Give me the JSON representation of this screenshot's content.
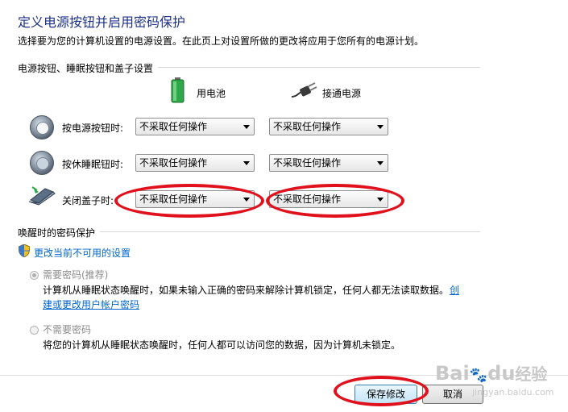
{
  "header": {
    "title": "定义电源按钮并启用密码保护",
    "description": "选择要为您的计算机设置的电源设置。在此页上对设置所做的更改将应用于您所有的电源计划。"
  },
  "power_section": {
    "label": "电源按钮、睡眠按钮和盖子设置",
    "columns": {
      "battery": "用电池",
      "plugged_in": "接通电源"
    },
    "rows": [
      {
        "label": "按电源按钮时:",
        "battery": "不采取任何操作",
        "plugged_in": "不采取任何操作"
      },
      {
        "label": "按休睡眠钮时:",
        "battery": "不采取任何操作",
        "plugged_in": "不采取任何操作"
      },
      {
        "label": "关闭盖子时:",
        "battery": "不采取任何操作",
        "plugged_in": "不采取任何操作"
      }
    ]
  },
  "password_section": {
    "label": "唤醒时的密码保护",
    "change_link": "更改当前不可用的设置",
    "options": [
      {
        "label": "需要密码(推荐)",
        "selected": true,
        "desc_line1": "计算机从睡眠状态唤醒时，如果未输入正确的密码来解除计算机锁定，任何人都无法读取数据。",
        "link_part1": "创",
        "link_part2": "建或更改用户帐户密码"
      },
      {
        "label": "不需要密码",
        "selected": false,
        "desc_line1": "将您的计算机从睡眠状态唤醒时，任何人都可以访问您的数据，因为计算机未锁定。"
      }
    ]
  },
  "buttons": {
    "save": "保存修改",
    "cancel": "取消"
  },
  "watermark": {
    "brand": "Bai",
    "paw": "🐾",
    "brand2": "du",
    "suffix": "经验",
    "url": "jingyan.baidu.com"
  },
  "colors": {
    "title": "#1e3287",
    "link": "#0066cc",
    "annotation": "#e0101c"
  }
}
